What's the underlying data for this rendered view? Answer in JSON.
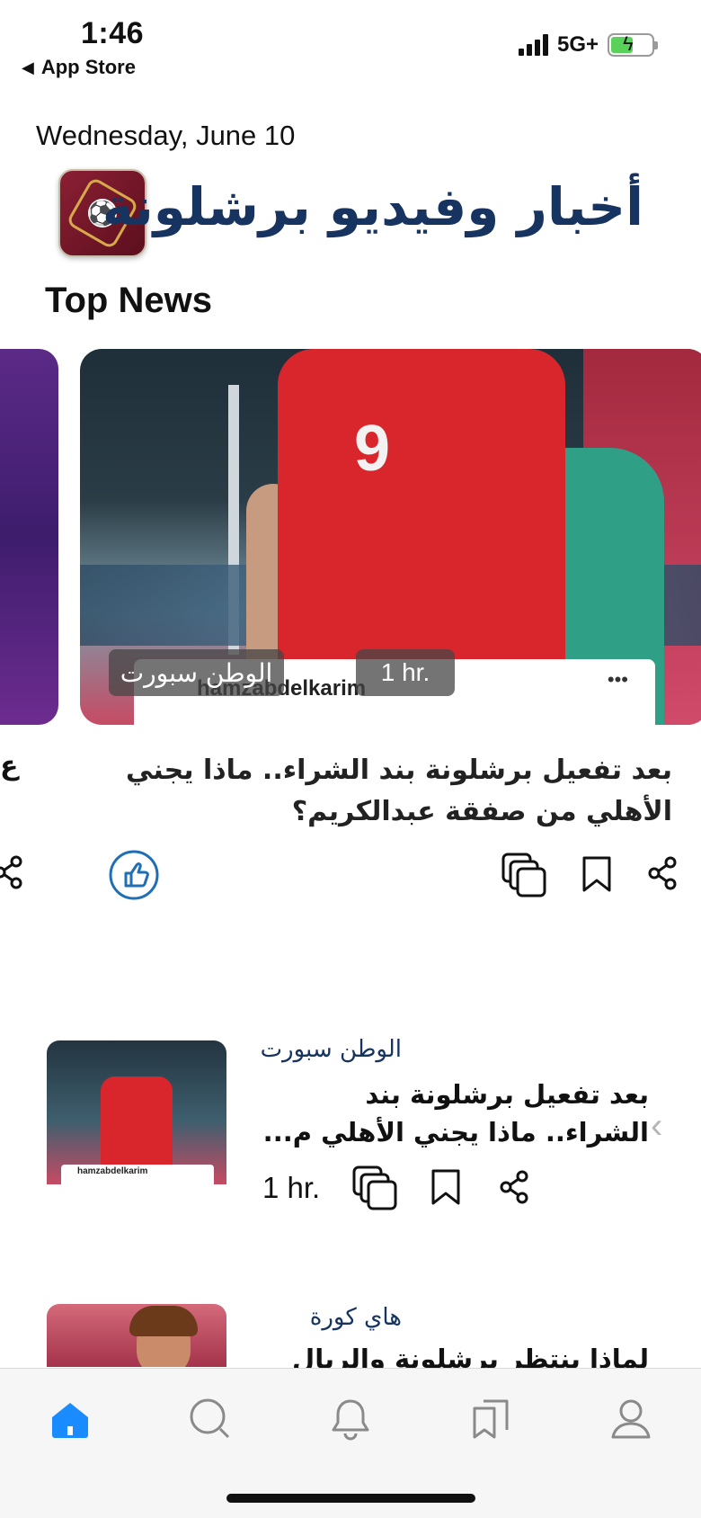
{
  "status": {
    "time": "1:46",
    "back_app": "App Store",
    "network": "5G+"
  },
  "header": {
    "date": "Wednesday, June 10",
    "app_title": "أخبار وفيديو برشلونة",
    "section_title": "Top News"
  },
  "hero": {
    "source": "الوطن سبورت",
    "time": "1 hr.",
    "image_caption": "hamzabdelkarim",
    "headline": "بعد تفعيل برشلونة بند الشراء.. ماذا يجني الأهلي من صفقة عبدالكريم؟",
    "prev_card_fragment": "ع"
  },
  "list": [
    {
      "source": "الوطن سبورت",
      "title": "بعد تفعيل برشلونة بند الشراء.. ماذا يجني الأهلي م...",
      "time": "1 hr.",
      "thumb_caption": "hamzabdelkarim"
    },
    {
      "source": "هاي كورة",
      "title": "لماذا ينتظر برشلونة والريال ما"
    }
  ],
  "tabbar": {
    "items": [
      "home-icon",
      "search-icon",
      "bell-icon",
      "cards-icon",
      "profile-icon"
    ],
    "active_color": "#1a8cff"
  },
  "colors": {
    "title_blue": "#17335f",
    "like_blue": "#1f6fb5"
  }
}
